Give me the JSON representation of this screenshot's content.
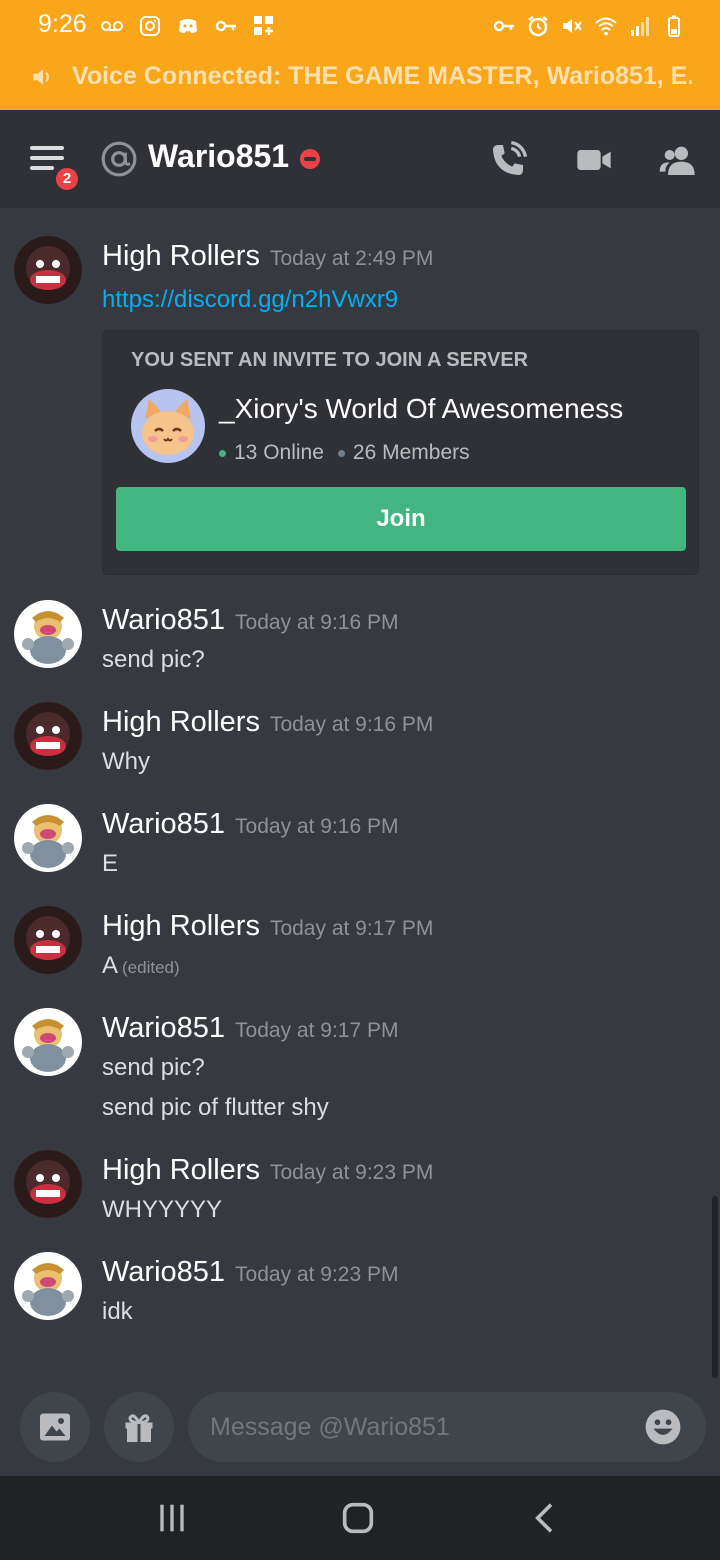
{
  "status_bar": {
    "time": "9:26",
    "voice_text": "Voice Connected: THE GAME MASTER, Wario851, E..."
  },
  "header": {
    "title": "Wario851",
    "unread_badge": "2"
  },
  "invite": {
    "heading": "YOU SENT AN INVITE TO JOIN A SERVER",
    "server_name": "_Xiory's World Of Awesomeness",
    "online": "13 Online",
    "members": "26 Members",
    "join_label": "Join"
  },
  "messages": [
    {
      "author": "High Rollers",
      "timestamp": "Today at 2:49 PM",
      "lines": [
        "https://discord.gg/n2hVwxr9"
      ]
    },
    {
      "author": "Wario851",
      "timestamp": "Today at 9:16 PM",
      "lines": [
        "send pic?"
      ]
    },
    {
      "author": "High Rollers",
      "timestamp": "Today at 9:16 PM",
      "lines": [
        "Why"
      ]
    },
    {
      "author": "Wario851",
      "timestamp": "Today at 9:16 PM",
      "lines": [
        "E"
      ]
    },
    {
      "author": "High Rollers",
      "timestamp": "Today at 9:17 PM",
      "lines": [
        "A"
      ],
      "edited": "(edited)"
    },
    {
      "author": "Wario851",
      "timestamp": "Today at 9:17 PM",
      "lines": [
        "send pic?",
        "send pic of flutter shy"
      ]
    },
    {
      "author": "High Rollers",
      "timestamp": "Today at 9:23 PM",
      "lines": [
        "WHYYYYY"
      ]
    },
    {
      "author": "Wario851",
      "timestamp": "Today at 9:23 PM",
      "lines": [
        "idk"
      ]
    }
  ],
  "composer": {
    "placeholder": "Message @Wario851"
  },
  "colors": {
    "accent_orange": "#faa61a",
    "join_green": "#43b581",
    "link_blue": "#00aff4",
    "dnd_red": "#ed4245"
  },
  "icons": {
    "header": [
      "menu-icon",
      "at-icon",
      "dnd-status-icon",
      "call-icon",
      "video-icon",
      "members-icon"
    ],
    "composer": [
      "image-icon",
      "gift-icon",
      "emoji-icon"
    ],
    "nav": [
      "recent-apps-icon",
      "home-icon",
      "back-icon"
    ]
  }
}
